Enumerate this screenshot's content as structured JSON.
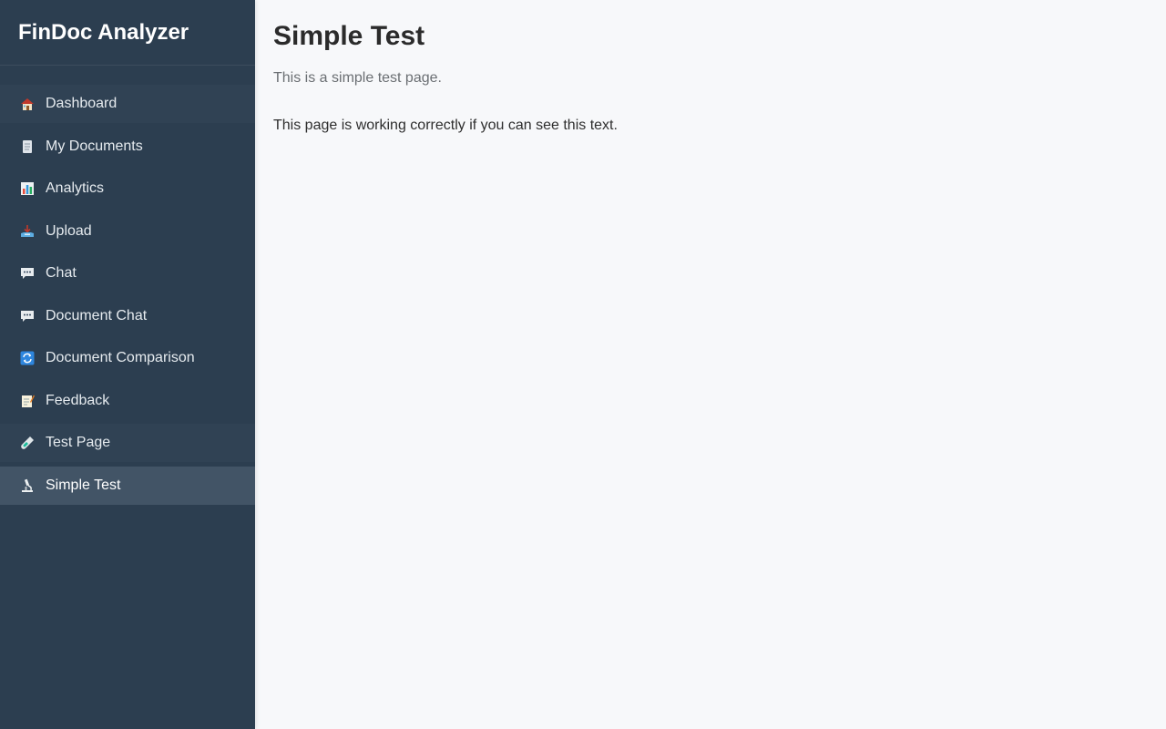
{
  "brand": {
    "title": "FinDoc Analyzer"
  },
  "sidebar": {
    "items": [
      {
        "label": "Dashboard",
        "icon": "house-icon"
      },
      {
        "label": "My Documents",
        "icon": "page-icon"
      },
      {
        "label": "Analytics",
        "icon": "bar-chart-icon"
      },
      {
        "label": "Upload",
        "icon": "inbox-tray-icon"
      },
      {
        "label": "Chat",
        "icon": "speech-bubble-icon"
      },
      {
        "label": "Document Chat",
        "icon": "speech-bubble-icon"
      },
      {
        "label": "Document Comparison",
        "icon": "refresh-arrows-icon"
      },
      {
        "label": "Feedback",
        "icon": "memo-icon"
      },
      {
        "label": "Test Page",
        "icon": "test-tube-icon"
      },
      {
        "label": "Simple Test",
        "icon": "microscope-icon",
        "active": true
      }
    ]
  },
  "main": {
    "title": "Simple Test",
    "subtitle": "This is a simple test page.",
    "body": "This page is working correctly if you can see this text."
  },
  "colors": {
    "sidebar_bg": "#2c3e50",
    "sidebar_active": "#425466",
    "main_bg": "#f7f8fa"
  }
}
